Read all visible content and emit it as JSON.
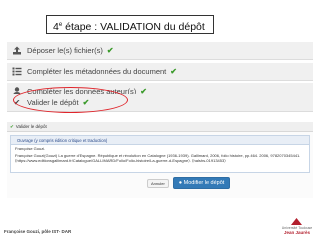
{
  "slide": {
    "title_number": "4",
    "title_suffix": "e",
    "title_text": " étape : VALIDATION du dépôt",
    "footer": "Françoise Gouzi, pôle IST- DAR"
  },
  "steps": [
    {
      "label": "Déposer le(s) fichier(s)",
      "icon": "upload-icon"
    },
    {
      "label": "Compléter les métadonnées du document",
      "icon": "list-icon"
    },
    {
      "label": "Compléter les données auteur(s)",
      "icon": "user-icon"
    },
    {
      "label": "Valider le dépôt",
      "icon": "check-icon"
    }
  ],
  "panel": {
    "header": "Valider le dépôt",
    "card_header": "Ouvrage (y compris édition critique et traduction)",
    "citation_author": "Françoise Gouzi.",
    "citation": "Françoise Gouzi(Gouzi) La guerre d'Espagne. République et révolution en Catalogne (1936-1939). Gallimard, 2006, folio histoire, pp.464. 2006, 9782070345441. ⟨https://www.editionsgallimard.fr/Catalogue/GALLIMARD/Folio/Folio-histoire/La-guerre-d-Espagne⟩. ⟨halshs-01913453⟩",
    "cancel_label": "Annuler",
    "edit_label": "Modifier le dépôt"
  },
  "logo": {
    "line1": "Université Toulouse",
    "line2": "Jean Jaurès"
  },
  "colors": {
    "check": "#3a9a2a",
    "highlight": "#e0252b",
    "primary_button": "#337ab7",
    "logo_red": "#b21f2d"
  }
}
